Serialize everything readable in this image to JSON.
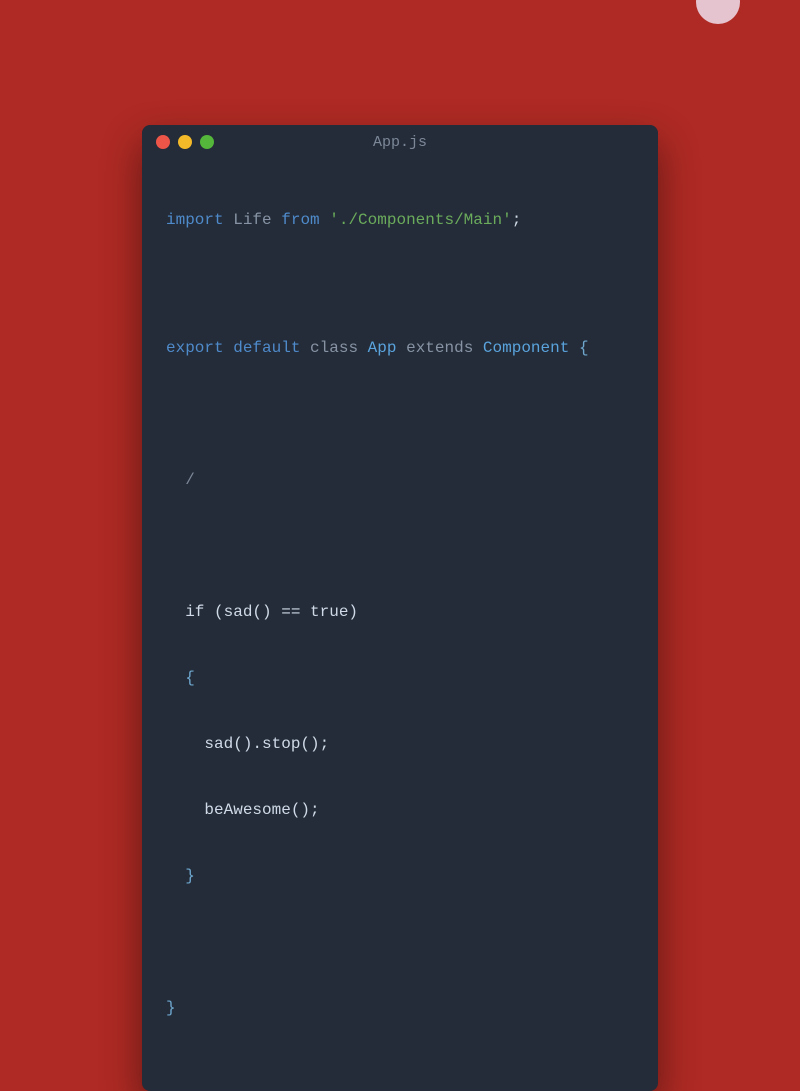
{
  "avatar": {
    "present": true
  },
  "window": {
    "title": "App.js",
    "traffic_lights": [
      "close",
      "minimize",
      "zoom"
    ]
  },
  "code": {
    "l1_import": "import",
    "l1_life": "Life",
    "l1_from": "from",
    "l1_path": "'./Components/Main'",
    "l1_semi": ";",
    "l2_export": "export",
    "l2_default": "default",
    "l2_class": "class",
    "l2_app": "App",
    "l2_extends": "extends",
    "l2_component": "Component",
    "l2_brace": "{",
    "l3_slash": "/",
    "l4_if": "if (sad() == true)",
    "l5_open": "{",
    "l6_stop": "sad().stop();",
    "l7_awesome": "beAwesome();",
    "l8_close": "}",
    "l9_close": "}"
  }
}
